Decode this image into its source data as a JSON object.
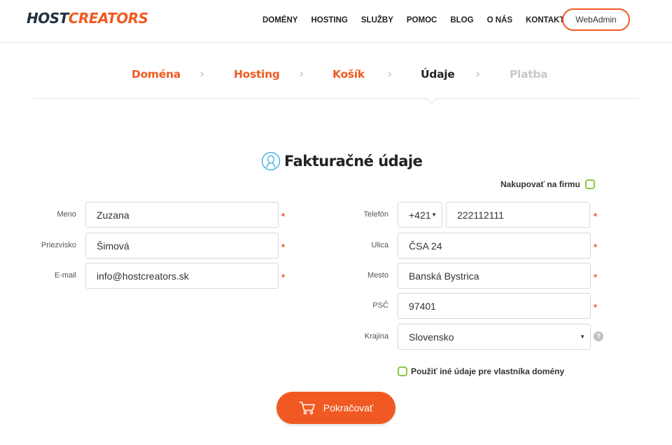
{
  "brand": {
    "part1": "HOST",
    "part2": "CREATORS",
    "accent": "#f05a22",
    "dark": "#22313f"
  },
  "nav": [
    "DOMÉNY",
    "HOSTING",
    "SLUŽBY",
    "POMOC",
    "BLOG",
    "O NÁS",
    "KONTAKT"
  ],
  "webadmin_label": "WebAdmin",
  "steps": [
    {
      "label": "Doména",
      "state": "done"
    },
    {
      "label": "Hosting",
      "state": "done"
    },
    {
      "label": "Košík",
      "state": "done"
    },
    {
      "label": "Údaje",
      "state": "active"
    },
    {
      "label": "Platba",
      "state": "todo"
    }
  ],
  "step_separator": "›",
  "form": {
    "title": "Fakturačné údaje",
    "title_icon": "person-icon",
    "company_toggle": {
      "label": "Nakupovať na firmu",
      "checked": false
    },
    "left": [
      {
        "label": "Meno",
        "value": "Zuzana",
        "required": true
      },
      {
        "label": "Priezvisko",
        "value": "Šimová",
        "required": true
      },
      {
        "label": "E-mail",
        "value": "info@hostcreators.sk",
        "required": true
      }
    ],
    "phone": {
      "label": "Telefón",
      "prefix": "+421",
      "value": "222112111",
      "required": true
    },
    "right": [
      {
        "label": "Ulica",
        "value": "ČSA 24",
        "required": true
      },
      {
        "label": "Mesto",
        "value": "Banská Bystrica",
        "required": true
      },
      {
        "label": "PSČ",
        "value": "97401",
        "required": true
      }
    ],
    "country": {
      "label": "Krajina",
      "value": "Slovensko"
    },
    "required_mark": "*",
    "help_mark": "?",
    "owner_toggle": {
      "label": "Použiť iné údaje pre vlastníka domény",
      "checked": false
    },
    "continue_label": "Pokračovať",
    "continue_icon": "cart-icon"
  }
}
